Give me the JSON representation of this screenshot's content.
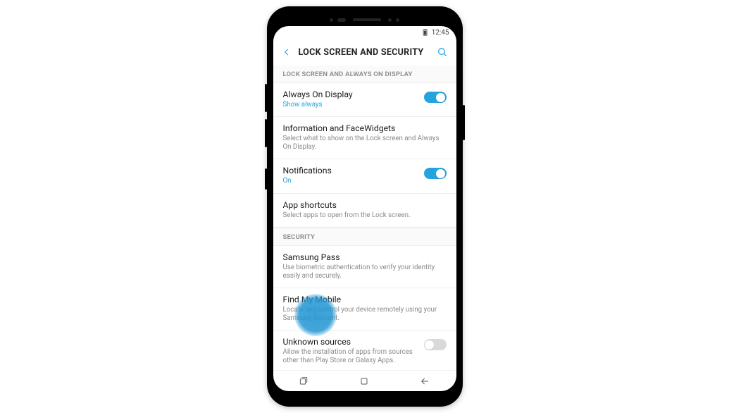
{
  "status": {
    "time": "12:45"
  },
  "header": {
    "title": "LOCK SCREEN AND SECURITY"
  },
  "sections": {
    "display": {
      "label": "LOCK SCREEN AND ALWAYS ON DISPLAY",
      "aod": {
        "title": "Always On Display",
        "sub": "Show always"
      },
      "info": {
        "title": "Information and FaceWidgets",
        "sub": "Select what to show on the Lock screen and Always On Display."
      },
      "notif": {
        "title": "Notifications",
        "sub": "On"
      },
      "shortcuts": {
        "title": "App shortcuts",
        "sub": "Select apps to open from the Lock screen."
      }
    },
    "security": {
      "label": "SECURITY",
      "pass": {
        "title": "Samsung Pass",
        "sub": "Use biometric authentication to verify your identity easily and securely."
      },
      "findmy": {
        "title": "Find My Mobile",
        "sub": "Locate and control your device remotely using your Samsung account."
      },
      "unknown": {
        "title": "Unknown sources",
        "sub": "Allow the installation of apps from sources other than Play Store or Galaxy Apps."
      }
    }
  }
}
